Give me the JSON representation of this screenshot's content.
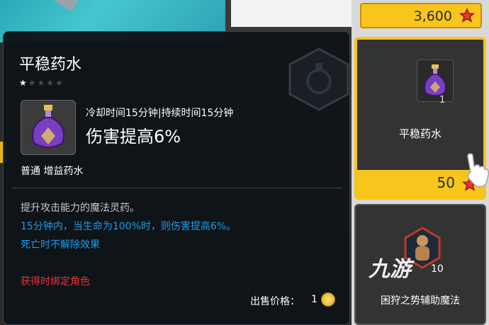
{
  "tooltip": {
    "title": "平稳药水",
    "stars_filled": 1,
    "stars_total": 5,
    "cooldown": "冷却时间15分钟|持续时间15分钟",
    "effect": "伤害提高6%",
    "category": "普通 增益药水",
    "description": "提升攻击能力的魔法灵药。",
    "detail_line1": "15分钟内，当生命为100%时，则伤害提高6%。",
    "detail_line2": "死亡时不解除效果",
    "bind_text": "获得时绑定角色",
    "sell_label": "出售价格：",
    "sell_value": "1"
  },
  "shop": {
    "top_price": "3,600",
    "selected_item": {
      "name": "平稳药水",
      "quantity": "1",
      "price": "50"
    },
    "second_item": {
      "name": "困狩之势辅助魔法",
      "quantity": "10"
    }
  },
  "watermark": "九游",
  "colors": {
    "gold": "#f7c51b",
    "desc_blue": "#1e9df0",
    "bind_red": "#e8343a",
    "star_red": "#e8343a"
  }
}
